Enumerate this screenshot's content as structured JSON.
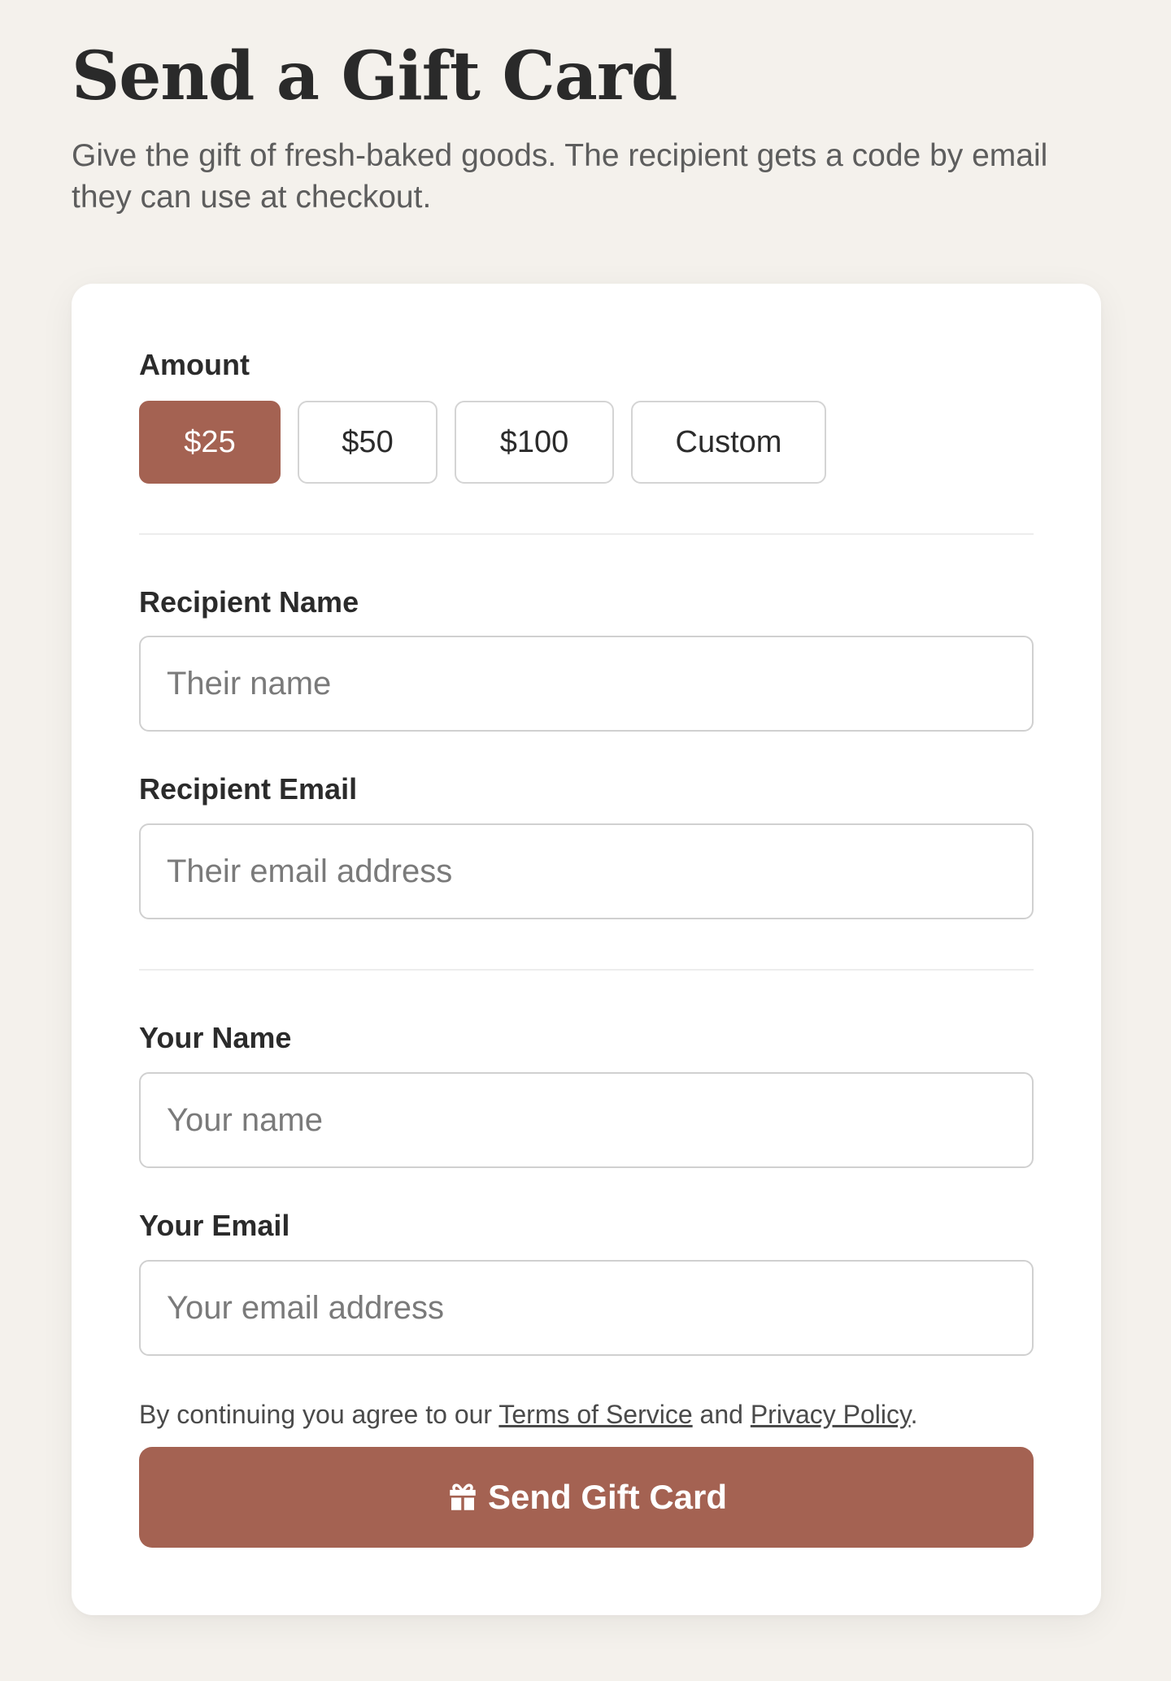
{
  "header": {
    "title": "Send a Gift Card",
    "subtitle": "Give the gift of fresh-baked goods. The recipient gets a code by email they can use at checkout."
  },
  "form": {
    "amount": {
      "label": "Amount",
      "options": [
        "$25",
        "$50",
        "$100",
        "Custom"
      ],
      "selected": "$25"
    },
    "recipient_name": {
      "label": "Recipient Name",
      "placeholder": "Their name"
    },
    "recipient_email": {
      "label": "Recipient Email",
      "placeholder": "Their email address"
    },
    "sender_name": {
      "label": "Your Name",
      "placeholder": "Your name"
    },
    "sender_email": {
      "label": "Your Email",
      "placeholder": "Your email address"
    },
    "terms": {
      "prefix": "By continuing you agree to our ",
      "tos_link": "Terms of Service",
      "middle": " and ",
      "privacy_link": "Privacy Policy",
      "suffix": "."
    },
    "submit_label": "Send Gift Card",
    "submit_icon": "gift-icon"
  },
  "colors": {
    "accent": "#a46252",
    "background": "#f4f1ec",
    "card": "#ffffff"
  }
}
